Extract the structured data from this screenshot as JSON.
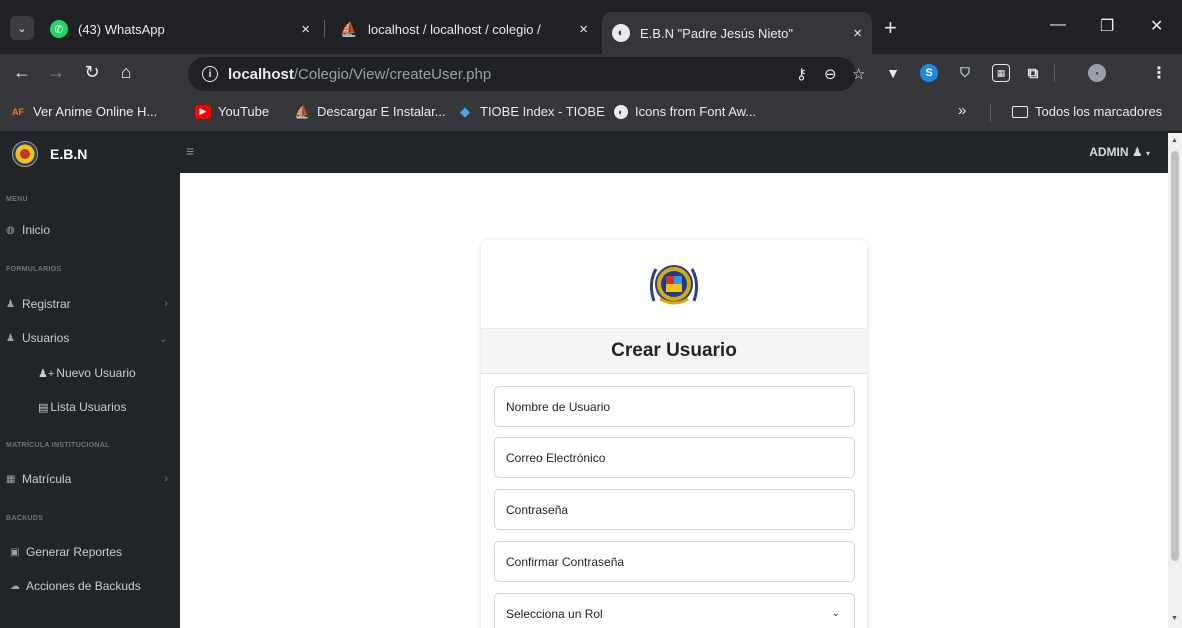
{
  "browser": {
    "tabs": [
      {
        "title": "(43) WhatsApp",
        "icon": "whatsapp-icon",
        "color": "#25D366"
      },
      {
        "title": "localhost / localhost / colegio / ",
        "icon": "phpmyadmin-icon",
        "color": "#f39c12"
      },
      {
        "title": "E.B.N \"Padre Jesús Nieto\"",
        "icon": "globe-icon",
        "color": "#e8eaed"
      }
    ],
    "address": {
      "host": "localhost",
      "path": "/Colegio/View/createUser.php"
    },
    "bookmarks": [
      {
        "label": "Ver Anime Online H...",
        "icon": "animeflv-icon",
        "badge": "AF",
        "color": "#e67e22"
      },
      {
        "label": "YouTube",
        "icon": "youtube-icon",
        "badge": "▶",
        "color": "#ff0000"
      },
      {
        "label": "Descargar E Instalar...",
        "icon": "ship-icon",
        "badge": "⛵",
        "color": "#3498db"
      },
      {
        "label": "TIOBE Index - TIOBE",
        "icon": "tiobe-icon",
        "badge": "◆",
        "color": "#3fa9f5"
      },
      {
        "label": "Icons from Font Aw...",
        "icon": "globe-icon",
        "badge": "◉",
        "color": "#e8eaed"
      }
    ],
    "overflow": "»",
    "all_bookmarks": "Todos los marcadores"
  },
  "app": {
    "brand": "E.B.N",
    "user": "ADMIN",
    "sidebar": {
      "headings": [
        "MENU",
        "FORMULARIOS",
        "MATRÍCULA INSTITUCIONAL",
        "BACKUDS"
      ],
      "items": {
        "inicio": "Inicio",
        "registrar": "Registrar",
        "usuarios": "Usuarios",
        "nuevo_usuario": "Nuevo Usuario",
        "lista_usuarios": "Lista Usuarios",
        "matricula": "Matrícula",
        "generar_reportes": "Generar Reportes",
        "acciones_backuds": "Acciones de Backuds"
      }
    },
    "form": {
      "title": "Crear Usuario",
      "username_placeholder": "Nombre de Usuario",
      "email_placeholder": "Correo Electrónico",
      "password_placeholder": "Contraseña",
      "confirm_placeholder": "Confirmar Contraseña",
      "role_selected": "Selecciona un Rol"
    }
  }
}
